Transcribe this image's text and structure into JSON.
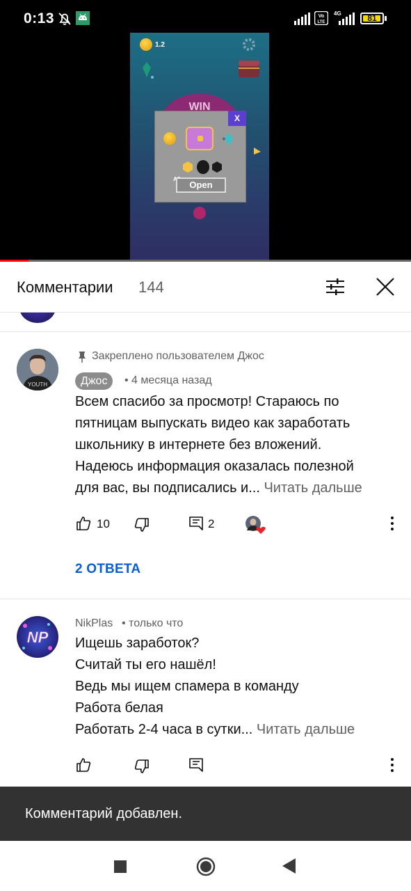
{
  "status_bar": {
    "time": "0:13",
    "battery": "81",
    "icons": [
      "bell-off-icon",
      "android-debug-icon",
      "signal-icon",
      "volte-icon",
      "4g-signal-icon",
      "battery-icon"
    ]
  },
  "video": {
    "game_coin_value": "1.2",
    "win_text": "WIN",
    "popup_close": "X",
    "ad_label": "AD",
    "open_button": "Open",
    "progress": 0.07
  },
  "comments_panel": {
    "title": "Комментарии",
    "count": "144",
    "filter_icon": "sort-filter-icon",
    "close_icon": "close-icon"
  },
  "comments": [
    {
      "pinned_text": "Закреплено пользователем Джос",
      "author": "Джос",
      "time": "• 4 месяца назад",
      "lines": [
        "Всем спасибо за просмотр! Стараюсь по",
        "пятницам выпускать видео как заработать",
        "школьнику в интернете без вложений.",
        "Надеюсь информация оказалась полезной",
        "для вас, вы подписались и..."
      ],
      "read_more": "Читать дальше",
      "likes": "10",
      "replies_count": "2",
      "replies_link": "2 ОТВЕТА"
    },
    {
      "author": "NikPlas",
      "time": "• только что",
      "avatar_text": "NP",
      "lines": [
        "Ищешь заработок?",
        "Считай ты его нашёл!",
        "Ведь мы ищем спамера в команду",
        "Работа белая",
        "Работать 2-4 часа в сутки..."
      ],
      "read_more": "Читать дальше"
    }
  ],
  "snackbar": {
    "message": "Комментарий добавлен."
  },
  "nav": {
    "icons": [
      "recents-square-icon",
      "home-circle-icon",
      "back-triangle-icon"
    ]
  },
  "colors": {
    "link_blue": "#065fd4",
    "secondary_text": "#606060",
    "snackbar_bg": "#323232",
    "progress_red": "#ff0000"
  }
}
